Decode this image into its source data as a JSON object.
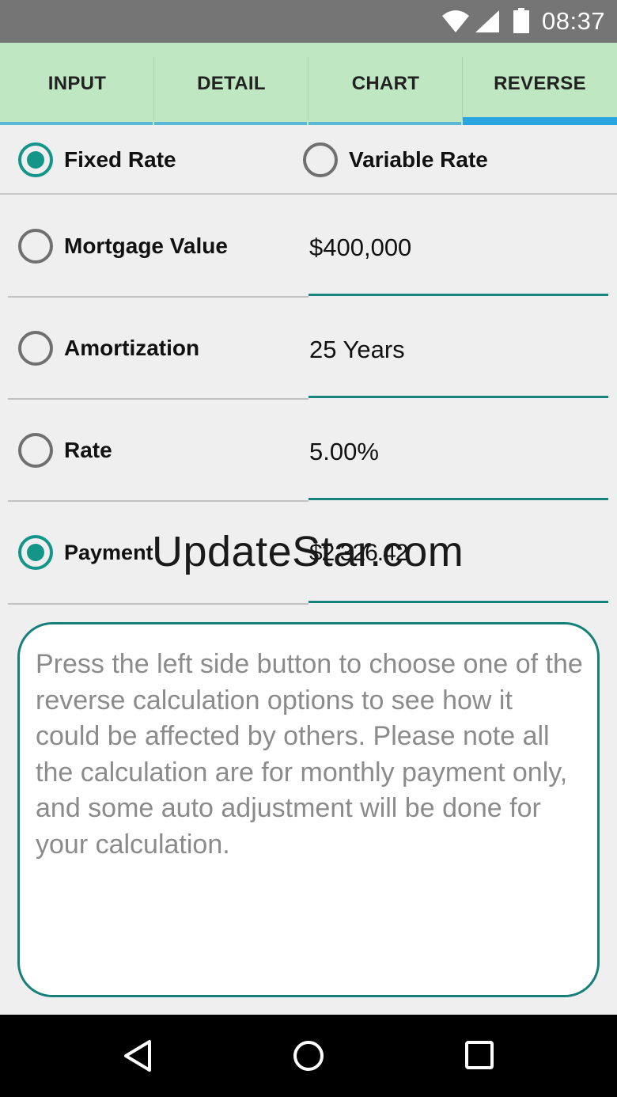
{
  "status_bar": {
    "time": "08:37",
    "icons": [
      "wifi-icon",
      "signal-icon",
      "battery-icon"
    ]
  },
  "tabs": [
    {
      "label": "INPUT",
      "active": false
    },
    {
      "label": "DETAIL",
      "active": false
    },
    {
      "label": "CHART",
      "active": false
    },
    {
      "label": "REVERSE",
      "active": true
    }
  ],
  "rate_type": {
    "fixed_label": "Fixed Rate",
    "fixed_selected": true,
    "variable_label": "Variable Rate",
    "variable_selected": false
  },
  "fields": {
    "mortgage": {
      "label": "Mortgage Value",
      "value": "$400,000",
      "selected": false
    },
    "amortization": {
      "label": "Amortization",
      "value": "25 Years",
      "selected": false
    },
    "rate": {
      "label": "Rate",
      "value": "5.00%",
      "selected": false
    },
    "payment": {
      "label": "Payment",
      "value": "$2,326.42",
      "selected": true
    }
  },
  "info_text": "Press the left side button to choose one of the reverse calculation options to see how it could be affected by others. Please note all the calculation are for monthly payment only, and some auto adjustment will be done for your calculation.",
  "watermark": "UpdateStar.com",
  "nav_bar": {
    "buttons": [
      "back-icon",
      "home-icon",
      "recents-icon"
    ]
  },
  "colors": {
    "accent": "#13958a",
    "tab_background": "#bfe8c2",
    "tab_indicator": "#2aa5e0",
    "status_bar": "#757575",
    "background": "#efefef"
  }
}
